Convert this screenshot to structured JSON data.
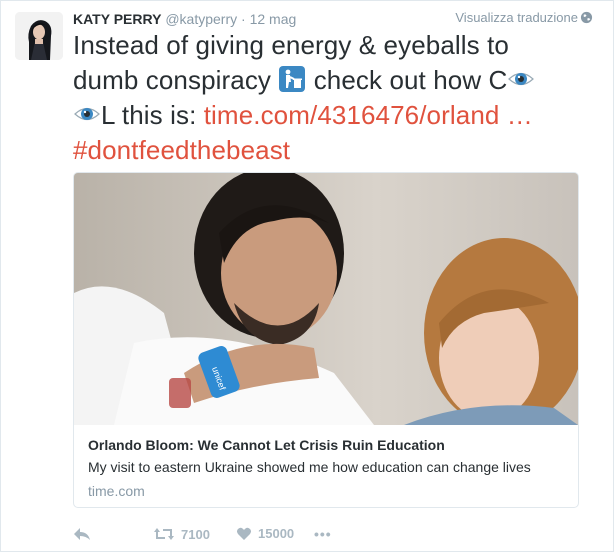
{
  "tweet": {
    "name": "KATY PERRY",
    "handle": "@katyperry",
    "separator": "·",
    "date": "12 mag",
    "translate_label": "Visualizza traduzione",
    "text_part1": "Instead of giving energy & eyeballs to dumb conspiracy ",
    "text_part2": " check out how C",
    "text_part3": "L this is: ",
    "link_text": "time.com/4316476/orland …",
    "hashtag": "#dontfeedthebeast"
  },
  "card": {
    "title": "Orlando Bloom: We Cannot Let Crisis Ruin Education",
    "description": "My visit to eastern Ukraine showed me how education can change lives",
    "domain": "time.com",
    "wristband_text": "unicef"
  },
  "actions": {
    "retweets": "7100",
    "likes": "15000",
    "more": "•••"
  },
  "colors": {
    "link": "#e0523e",
    "muted": "#8899a6",
    "text": "#292f33"
  }
}
